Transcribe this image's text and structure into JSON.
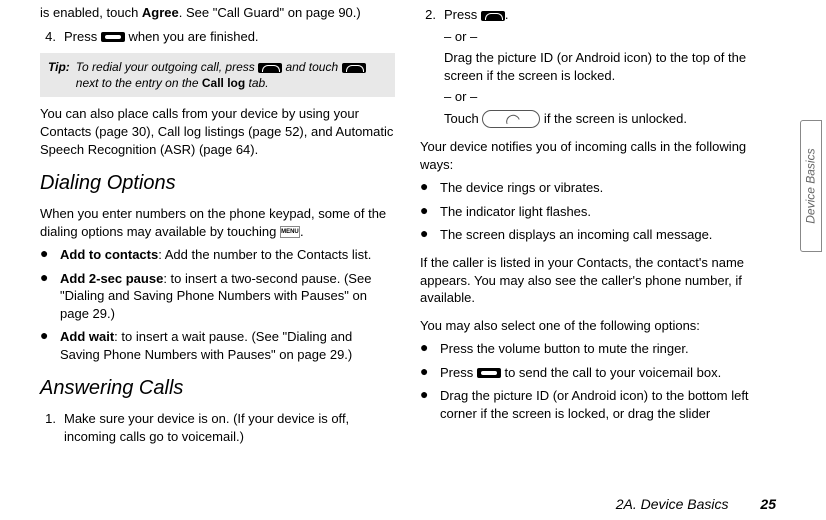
{
  "left": {
    "intro1a": "is enabled, touch ",
    "intro1b": ". See \"Call Guard\" on page 90.)",
    "agree": "Agree",
    "step4_before": "Press ",
    "step4_after": " when you are finished.",
    "tip_label": "Tip:",
    "tip_before": "To redial your outgoing call, press ",
    "tip_mid": " and touch ",
    "tip_after1": " next to the entry on the ",
    "tip_bold": "Call log",
    "tip_after2": " tab.",
    "para2": "You can also place calls from your device by using your Contacts (page 30), Call log listings (page 52), and Automatic Speech Recognition (ASR) (page 64).",
    "h_dialing": "Dialing Options",
    "para3_before": "When you enter numbers on the phone keypad, some of the dialing options may available by touching ",
    "para3_after": ".",
    "menu_text": "MENU",
    "b1_label": "Add to contacts",
    "b1_rest": ": Add the number to the Contacts list.",
    "b2_label": "Add 2-sec pause",
    "b2_rest": ": to insert a two-second pause. (See \"Dialing and Saving Phone Numbers with Pauses\" on page 29.)",
    "b3_label": "Add wait",
    "b3_rest": ": to insert a wait pause. (See \"Dialing and Saving Phone Numbers with Pauses\" on page 29.)",
    "h_answering": "Answering Calls",
    "step1": "Make sure your device is on. (If your device is off, incoming calls go to voicemail.)"
  },
  "right": {
    "step2_before": "Press ",
    "step2_after": ".",
    "or": "– or –",
    "alt1": "Drag the picture ID (or Android icon) to the top of the screen if the screen is locked.",
    "alt2_before": "Touch ",
    "alt2_after": " if the screen is unlocked.",
    "para1": "Your device notifies you of incoming calls in the following ways:",
    "n1": "The device rings or vibrates.",
    "n2": "The indicator light flashes.",
    "n3": "The screen displays an incoming call message.",
    "para2": "If the caller is listed in your Contacts, the contact's name appears. You may also see the caller's phone number, if available.",
    "para3": "You may also select one of the following options:",
    "o1": "Press the volume button to mute the ringer.",
    "o2_before": "Press ",
    "o2_after": " to send the call to your voicemail box.",
    "o3": "Drag the picture ID (or Android icon) to the bottom left corner if the screen is locked, or drag the slider"
  },
  "side_tab": "Device Basics",
  "footer_section": "2A. Device Basics",
  "footer_page": "25"
}
